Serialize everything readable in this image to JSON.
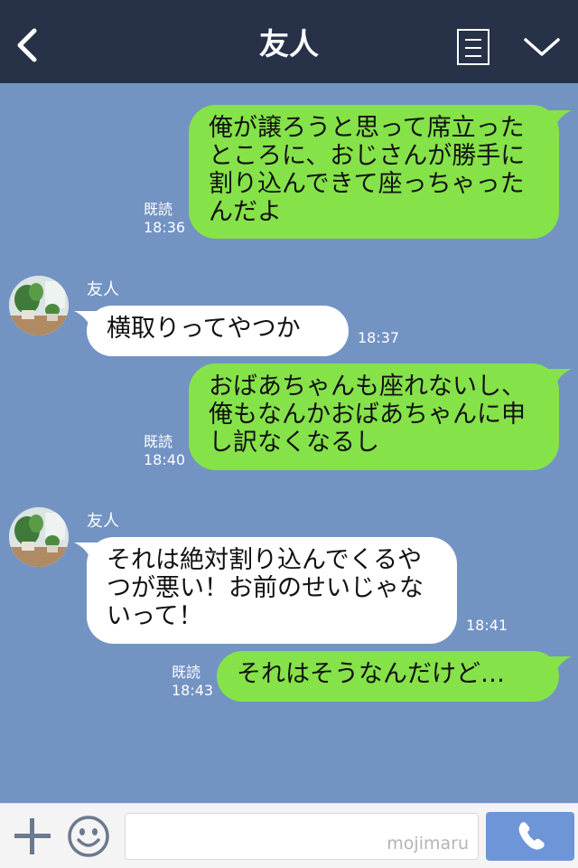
{
  "header": {
    "title": "友人",
    "back_icon": "chevron-left-icon",
    "menu_icon": "notes-icon",
    "collapse_icon": "chevron-down-icon"
  },
  "messages": [
    {
      "sender": "me",
      "text": "俺が譲ろうと思って席立ったところに、おじさんが勝手に割り込んできて座っちゃったんだよ",
      "read": "既読",
      "time": "18:36"
    },
    {
      "sender": "them",
      "name": "友人",
      "text": "横取りってやつか",
      "time": "18:37"
    },
    {
      "sender": "me",
      "text": "おばあちゃんも座れないし、俺もなんかおばあちゃんに申し訳なくなるし",
      "read": "既読",
      "time": "18:40"
    },
    {
      "sender": "them",
      "name": "友人",
      "text": "それは絶対割り込んでくるやつが悪い！お前のせいじゃないって！",
      "time": "18:41"
    },
    {
      "sender": "me",
      "text": "それはそうなんだけど…",
      "read": "既読",
      "time": "18:43"
    }
  ],
  "footer": {
    "plus_icon": "plus-icon",
    "emoji_icon": "smiley-icon",
    "input_value": "",
    "watermark": "mojimaru",
    "call_icon": "phone-icon"
  },
  "colors": {
    "header_bg": "#273148",
    "chat_bg": "#7393c3",
    "my_bubble": "#85e249",
    "their_bubble": "#ffffff",
    "call_button": "#6f95d9"
  }
}
